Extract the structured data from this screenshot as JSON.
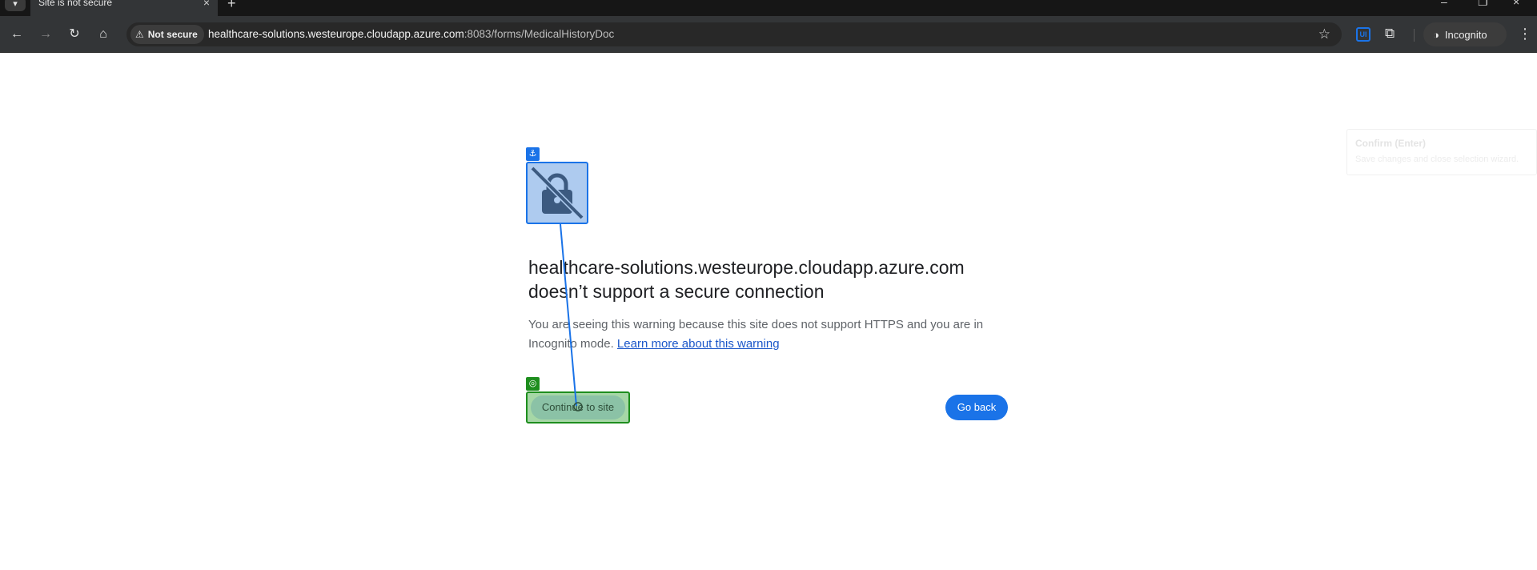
{
  "browser": {
    "tab_title": "Site is not secure",
    "tab_close_icon": "close-icon",
    "new_tab_icon": "plus-icon",
    "security_label": "Not secure",
    "url_host": "healthcare-solutions.westeurope.cloudapp.azure.com",
    "url_rest": ":8083/forms/MedicalHistoryDoc",
    "extension_badge": "UI",
    "incognito_label": "Incognito"
  },
  "page": {
    "heading": "healthcare-solutions.westeurope.cloudapp.azure.com doesn’t support a secure connection",
    "body": "You are seeing this warning because this site does not support HTTPS and you are in Incognito mode.",
    "learn_more": "Learn more about this warning",
    "continue_label": "Continue to site",
    "go_back_label": "Go back"
  },
  "overlay": {
    "tooltip_title": "Confirm (Enter)",
    "tooltip_subtitle": "Save changes and close selection wizard."
  },
  "colors": {
    "accent": "#1a73e8",
    "selection_green": "#1e8e1e",
    "toolbar": "#333537"
  }
}
